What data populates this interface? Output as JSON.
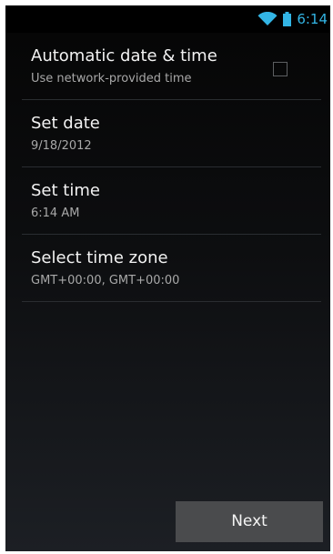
{
  "status_bar": {
    "time": "6:14",
    "icons": [
      "wifi-icon",
      "battery-icon"
    ],
    "clock_color": "#33b5e5"
  },
  "settings": {
    "automatic": {
      "title": "Automatic date & time",
      "summary": "Use network-provided time",
      "checked": false
    },
    "date": {
      "title": "Set date",
      "summary": "9/18/2012"
    },
    "time": {
      "title": "Set time",
      "summary": "6:14 AM"
    },
    "timezone": {
      "title": "Select time zone",
      "summary": "GMT+00:00, GMT+00:00"
    }
  },
  "footer": {
    "next_label": "Next"
  }
}
